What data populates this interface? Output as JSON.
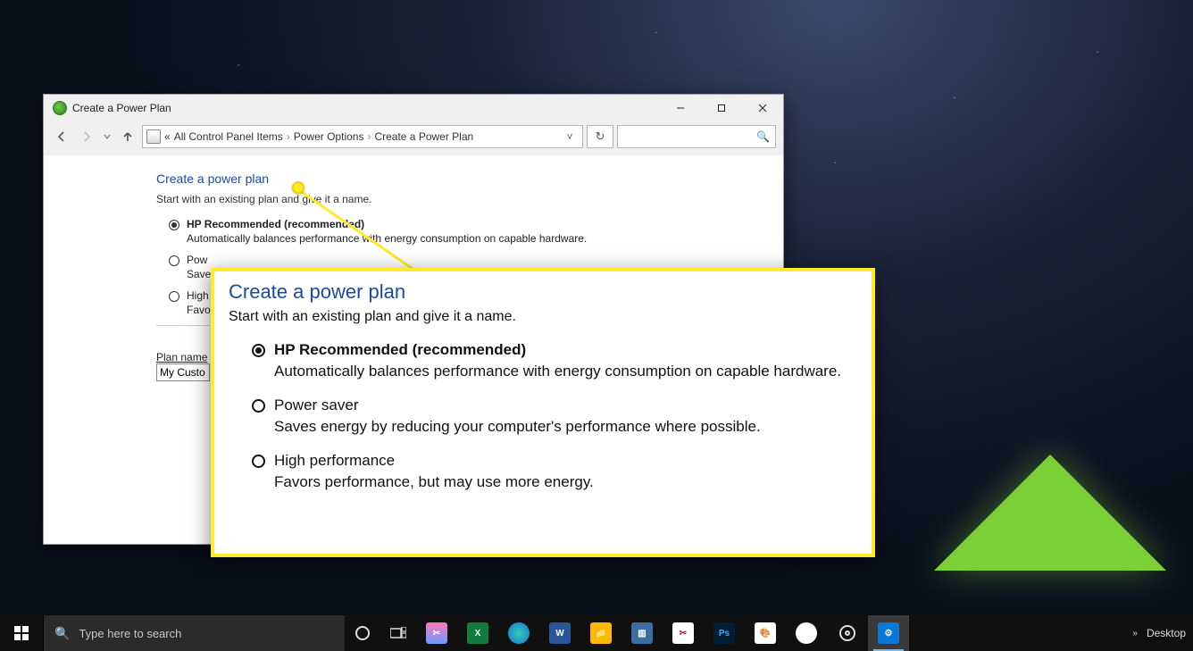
{
  "window": {
    "title": "Create a Power Plan",
    "breadcrumb": {
      "prefix": "«",
      "items": [
        "All Control Panel Items",
        "Power Options",
        "Create a Power Plan"
      ]
    }
  },
  "page": {
    "heading": "Create a power plan",
    "sub": "Start with an existing plan and give it a name.",
    "options": [
      {
        "label": "HP Recommended (recommended)",
        "desc": "Automatically balances performance with energy consumption on capable hardware.",
        "checked": true
      },
      {
        "label": "Power saver",
        "desc": "Saves energy by reducing your computer's performance where possible.",
        "checked": false
      },
      {
        "label": "High performance",
        "desc": "Favors performance, but may use more energy.",
        "checked": false
      }
    ],
    "plan_name_label": "Plan name",
    "plan_name_value": "My Custo"
  },
  "callout": {
    "heading": "Create a power plan",
    "sub": "Start with an existing plan and give it a name.",
    "options": [
      {
        "label": "HP Recommended (recommended)",
        "desc": "Automatically balances performance with energy consumption on capable hardware.",
        "checked": true
      },
      {
        "label": "Power saver",
        "desc": "Saves energy by reducing your computer's performance where possible.",
        "checked": false
      },
      {
        "label": "High performance",
        "desc": "Favors performance, but may use more energy.",
        "checked": false
      }
    ]
  },
  "taskbar": {
    "search_placeholder": "Type here to search",
    "desktop_label": "Desktop"
  }
}
